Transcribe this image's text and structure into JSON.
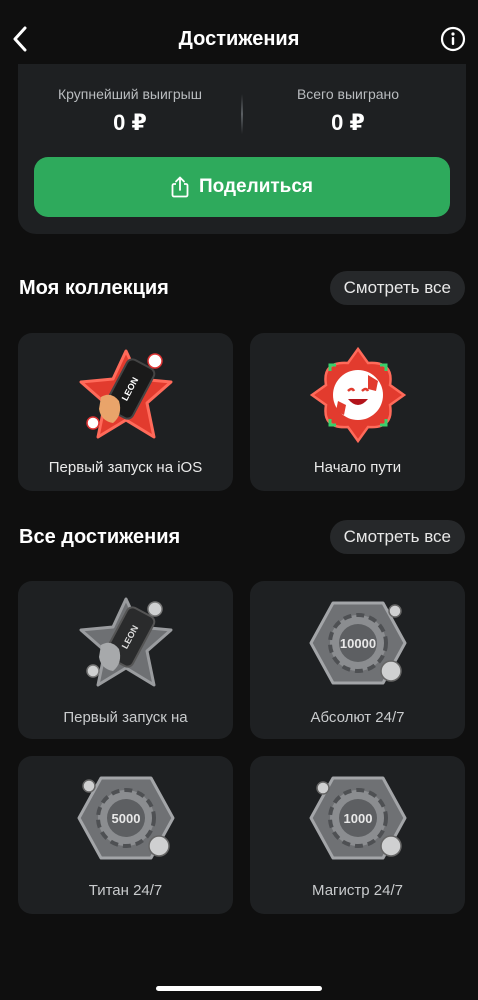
{
  "header": {
    "title": "Достижения",
    "back_icon": "chevron-left-icon",
    "info_icon": "info-icon"
  },
  "stats": {
    "biggest_win_label": "Крупнейший выигрыш",
    "biggest_win_value": "0 ₽",
    "total_won_label": "Всего выиграно",
    "total_won_value": "0 ₽",
    "share_label": "Поделиться",
    "share_icon": "share-icon",
    "accent": "#2eaa5c"
  },
  "collection": {
    "title": "Моя коллекция",
    "see_all": "Смотреть все",
    "items": [
      {
        "label": "Первый запуск на iOS",
        "icon": "phone-star-badge-icon"
      },
      {
        "label": "Начало пути",
        "icon": "football-smile-badge-icon"
      }
    ]
  },
  "all": {
    "title": "Все достижения",
    "see_all": "Смотреть все",
    "items": [
      {
        "label": "Первый запуск на",
        "icon": "phone-star-badge-gray-icon"
      },
      {
        "label": "Абсолют 24/7",
        "icon": "chip-badge-icon",
        "badge_text": "10000"
      },
      {
        "label": "Титан 24/7",
        "icon": "chip-badge-icon",
        "badge_text": "5000"
      },
      {
        "label": "Магистр 24/7",
        "icon": "chip-badge-icon",
        "badge_text": "1000"
      }
    ]
  },
  "brand_text": "LEON"
}
